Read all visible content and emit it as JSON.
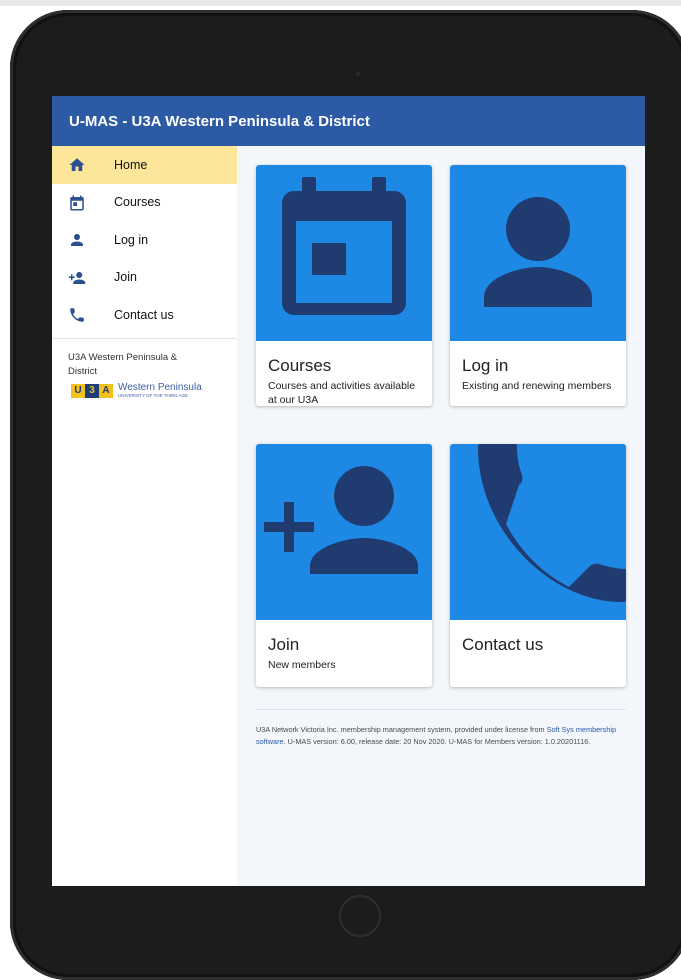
{
  "app": {
    "title": "U-MAS - U3A Western Peninsula & District"
  },
  "colors": {
    "appbar": "#2c5aa5",
    "active_nav": "#fde59a",
    "card_media": "#1e88e5",
    "icon_fill": "#1f3b70"
  },
  "sidebar": {
    "items": [
      {
        "label": "Home",
        "icon": "home-icon",
        "active": true
      },
      {
        "label": "Courses",
        "icon": "calendar-icon",
        "active": false
      },
      {
        "label": "Log in",
        "icon": "person-icon",
        "active": false
      },
      {
        "label": "Join",
        "icon": "person-add-icon",
        "active": false
      },
      {
        "label": "Contact us",
        "icon": "phone-icon",
        "active": false
      }
    ],
    "org_name": "U3A Western Peninsula & District",
    "logo": {
      "letters": [
        "U",
        "3",
        "A"
      ],
      "name": "Western Peninsula",
      "subtitle": "UNIVERSITY OF THE THIRD AGE"
    }
  },
  "cards": [
    {
      "title": "Courses",
      "description": "Courses and activities available at our U3A",
      "icon": "calendar-icon"
    },
    {
      "title": "Log in",
      "description": "Existing and renewing members",
      "icon": "person-icon"
    },
    {
      "title": "Join",
      "description": "New members",
      "icon": "person-add-icon"
    },
    {
      "title": "Contact us",
      "description": "",
      "icon": "phone-icon"
    }
  ],
  "footer": {
    "prefix": "U3A Network Victoria Inc. membership management system, provided under license from ",
    "link_text": "Soft Sys membership software",
    "suffix": ". U-MAS version: 6.00, release date: 20 Nov 2020. U-MAS for Members version: 1.0.20201116."
  }
}
